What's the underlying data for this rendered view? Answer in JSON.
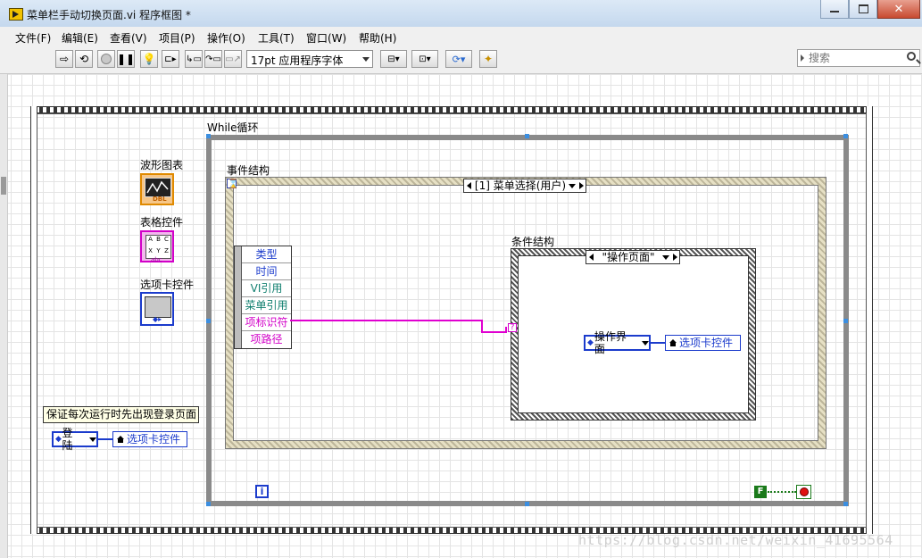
{
  "window": {
    "title": "菜单栏手动切换页面.vi 程序框图 *"
  },
  "menu": [
    {
      "label": "文件(F)"
    },
    {
      "label": "编辑(E)"
    },
    {
      "label": "查看(V)"
    },
    {
      "label": "项目(P)"
    },
    {
      "label": "操作(O)"
    },
    {
      "label": "工具(T)"
    },
    {
      "label": "窗口(W)"
    },
    {
      "label": "帮助(H)"
    }
  ],
  "toolbar": {
    "font": "17pt 应用程序字体",
    "search_placeholder": "搜索"
  },
  "diagram": {
    "while_label": "While循环",
    "event_label": "事件结构",
    "event_timeout": "⌛",
    "event_case": "[1] 菜单选择(用户)",
    "event_data": [
      "类型",
      "时间",
      "VI引用",
      "菜单引用",
      "项标识符",
      "项路径"
    ],
    "case_label": "条件结构",
    "case_value": "\"操作页面\"",
    "case_selector": "?",
    "enum_inner": "操作界面",
    "ref_inner": "选项卡控件",
    "terminals": [
      {
        "label": "波形图表"
      },
      {
        "label": "表格控件"
      },
      {
        "label": "选项卡控件"
      }
    ],
    "comment": "保证每次运行时先出现登录页面",
    "enum_outer": "登陆",
    "ref_outer": "选项卡控件",
    "iteration": "i",
    "false_const": "F"
  },
  "icons": {
    "waveform": "DBL",
    "table": [
      "A",
      "B",
      "C",
      "X",
      "Y",
      "Z",
      "abc"
    ],
    "tab": "◆▸"
  },
  "watermark": "https://blog.csdn.net/weixin_41695564"
}
